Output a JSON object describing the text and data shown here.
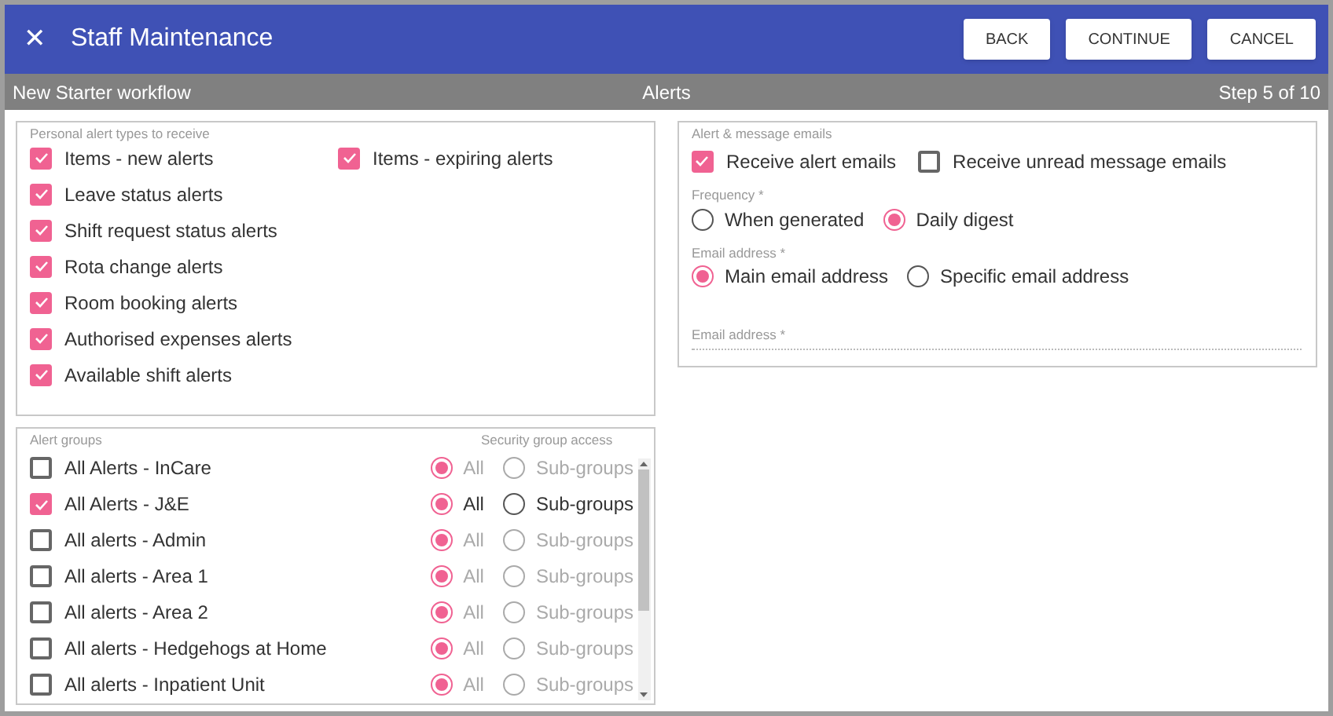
{
  "header": {
    "close_icon": "✕",
    "title": "Staff Maintenance",
    "buttons": [
      "BACK",
      "CONTINUE",
      "CANCEL"
    ]
  },
  "step_bar": {
    "workflow": "New Starter workflow",
    "page": "Alerts",
    "step": "Step 5 of 10"
  },
  "personal_alerts": {
    "legend": "Personal alert types to receive",
    "items": [
      {
        "label": "Items - new alerts",
        "checked": true
      },
      {
        "label": "Items - expiring alerts",
        "checked": true
      },
      {
        "label": "Leave status alerts",
        "checked": true
      },
      {
        "label": "Shift request status alerts",
        "checked": true
      },
      {
        "label": "Rota change alerts",
        "checked": true
      },
      {
        "label": "Room booking alerts",
        "checked": true
      },
      {
        "label": "Authorised expenses alerts",
        "checked": true
      },
      {
        "label": "Available shift alerts",
        "checked": true
      }
    ]
  },
  "alert_groups": {
    "legend": "Alert groups",
    "access_legend": "Security group access",
    "groups": [
      {
        "label": "All Alerts - InCare",
        "checked": false,
        "options": [
          {
            "label": "All",
            "selected": true
          },
          {
            "label": "Sub-groups",
            "selected": false
          }
        ]
      },
      {
        "label": "All Alerts - J&E",
        "checked": true,
        "options": [
          {
            "label": "All",
            "selected": true
          },
          {
            "label": "Sub-groups",
            "selected": false
          }
        ]
      },
      {
        "label": "All alerts - Admin",
        "checked": false,
        "options": [
          {
            "label": "All",
            "selected": true
          },
          {
            "label": "Sub-groups",
            "selected": false
          }
        ]
      },
      {
        "label": "All alerts - Area 1",
        "checked": false,
        "options": [
          {
            "label": "All",
            "selected": true
          },
          {
            "label": "Sub-groups",
            "selected": false
          }
        ]
      },
      {
        "label": "All alerts - Area 2",
        "checked": false,
        "options": [
          {
            "label": "All",
            "selected": true
          },
          {
            "label": "Sub-groups",
            "selected": false
          }
        ]
      },
      {
        "label": "All alerts - Hedgehogs at Home",
        "checked": false,
        "options": [
          {
            "label": "All",
            "selected": true
          },
          {
            "label": "Sub-groups",
            "selected": false
          }
        ]
      },
      {
        "label": "All alerts - Inpatient Unit",
        "checked": false,
        "options": [
          {
            "label": "All",
            "selected": true
          },
          {
            "label": "Sub-groups",
            "selected": false
          }
        ]
      }
    ]
  },
  "emails": {
    "legend": "Alert & message emails",
    "checks": [
      {
        "label": "Receive alert emails",
        "checked": true
      },
      {
        "label": "Receive unread message emails",
        "checked": false
      }
    ],
    "frequency": {
      "label": "Frequency *",
      "options": [
        {
          "label": "When generated",
          "selected": false
        },
        {
          "label": "Daily digest",
          "selected": true
        }
      ]
    },
    "address_choice": {
      "label": "Email address *",
      "options": [
        {
          "label": "Main email address",
          "selected": true
        },
        {
          "label": "Specific email address",
          "selected": false
        }
      ]
    },
    "address_field": {
      "placeholder": "Email address *"
    }
  }
}
